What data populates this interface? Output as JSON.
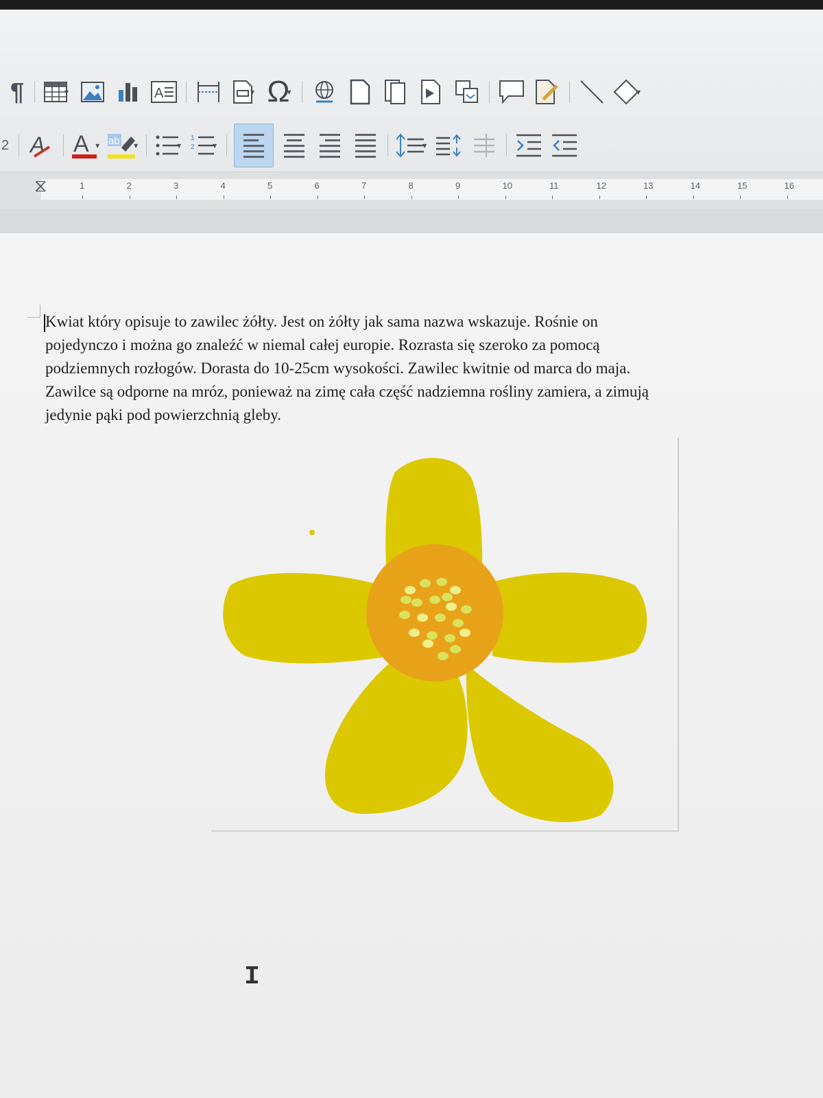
{
  "toolbar": {
    "row1": [
      {
        "name": "formatting-marks-icon",
        "glyph": "¶"
      },
      {
        "name": "insert-table-icon",
        "glyph": "▦",
        "dropdown": true
      },
      {
        "name": "insert-image-icon",
        "glyph": "🖼"
      },
      {
        "name": "insert-chart-icon",
        "glyph": "▮"
      },
      {
        "name": "insert-textbox-icon",
        "glyph": "A"
      },
      {
        "name": "insert-page-break-icon",
        "glyph": "⇹"
      },
      {
        "name": "insert-field-icon",
        "glyph": "⊟",
        "dropdown": true
      },
      {
        "name": "insert-special-character-icon",
        "glyph": "Ω",
        "dropdown": true
      },
      {
        "name": "insert-hyperlink-icon",
        "glyph": "🌐"
      },
      {
        "name": "insert-footnote-icon",
        "glyph": "▯"
      },
      {
        "name": "insert-endnote-icon",
        "glyph": "▯"
      },
      {
        "name": "insert-bookmark-icon",
        "glyph": "▶"
      },
      {
        "name": "insert-cross-reference-icon",
        "glyph": "⧉"
      },
      {
        "name": "insert-comment-icon",
        "glyph": "▢"
      },
      {
        "name": "track-changes-icon",
        "glyph": "✎"
      },
      {
        "name": "insert-line-icon",
        "glyph": "╲"
      },
      {
        "name": "basic-shapes-icon",
        "glyph": "◇",
        "dropdown": true
      }
    ],
    "heading_fragment": "2",
    "highlight_label": "ab"
  },
  "ruler": {
    "numbers": [
      "1",
      "2",
      "3",
      "4",
      "5",
      "6",
      "7",
      "8",
      "9",
      "10",
      "11",
      "12",
      "13",
      "14",
      "15",
      "16"
    ]
  },
  "document": {
    "lines": [
      "Kwiat który opisuje to zawilec żółty. Jest on żółty jak sama nazwa  wskazuje. Rośnie on",
      "pojedynczo i można go znaleźć w niemal całej europie. Rozrasta się szeroko za pomocą",
      "podziemnych rozłogów. Dorasta do 10-25cm wysokości. Zawilec kwitnie od marca do maja.",
      "Zawilce są odporne na mróz, ponieważ na zimę cała część nadziemna rośliny zamiera, a zimują",
      "jedynie pąki pod powierzchnią gleby."
    ]
  },
  "colors": {
    "petal": "#dcc800",
    "center": "#e8a21a",
    "stamen": "#d9e25a",
    "stamen_light": "#eef08a"
  }
}
